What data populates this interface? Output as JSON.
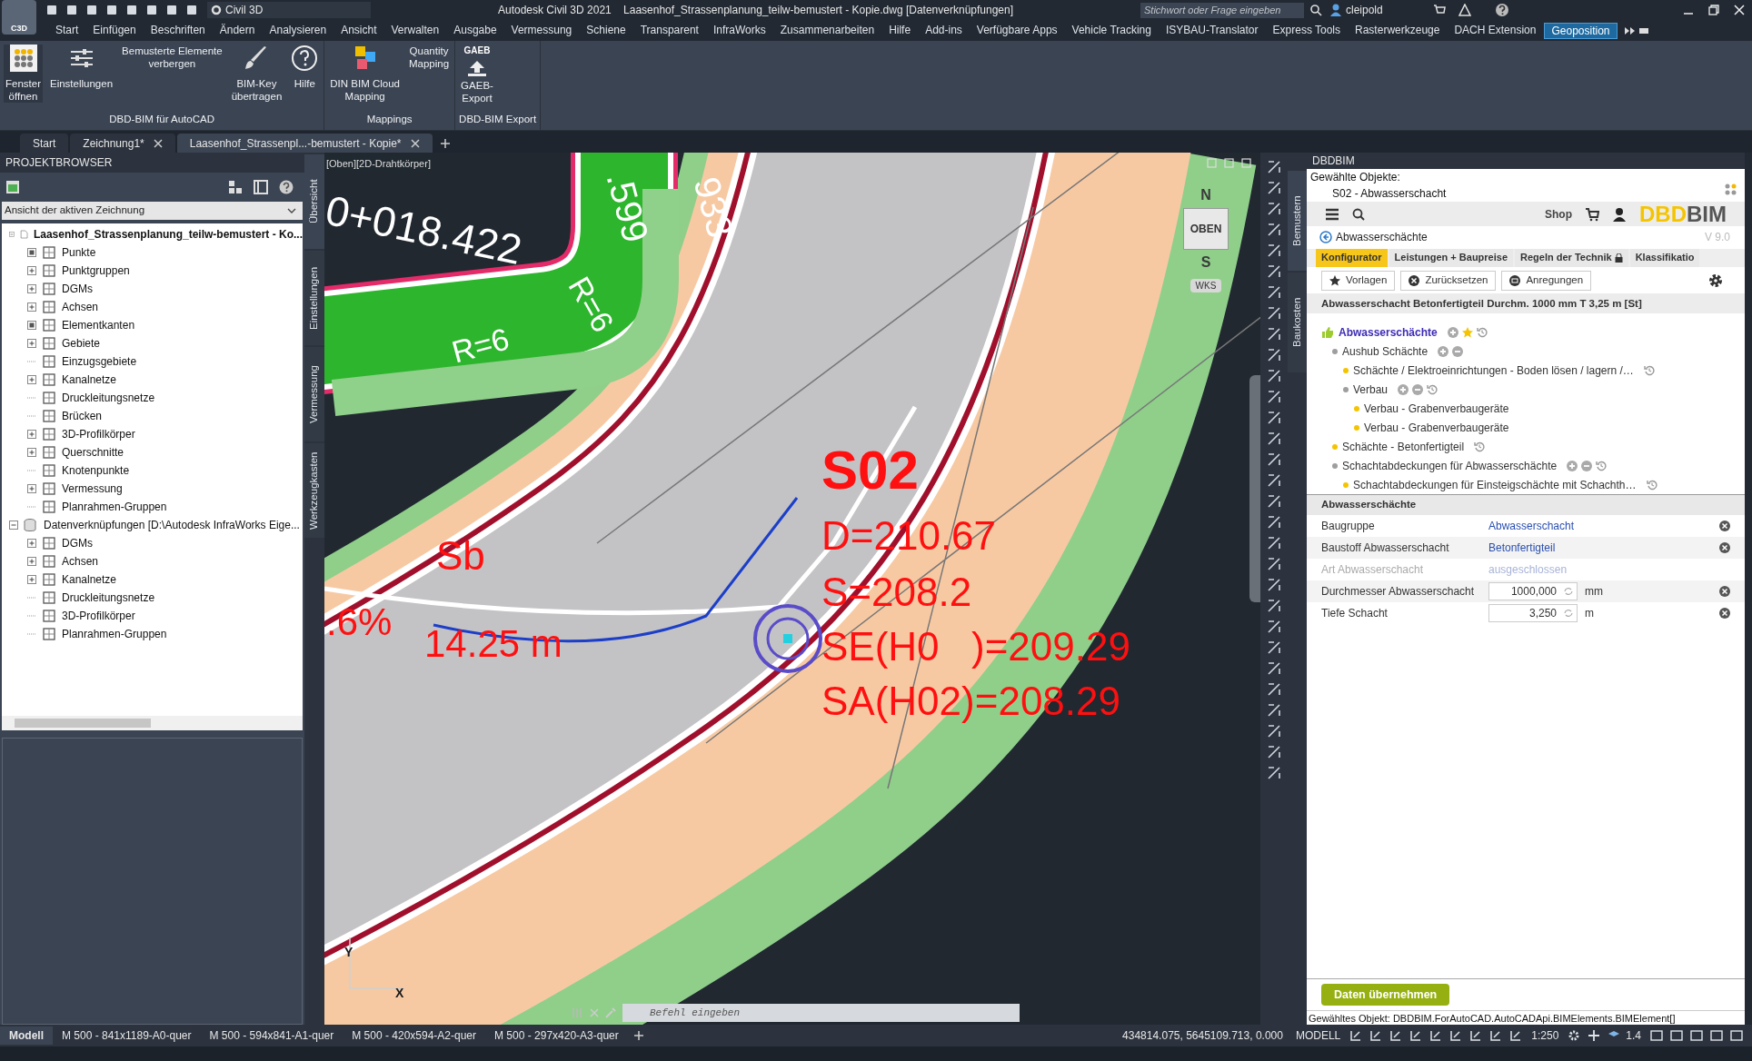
{
  "title_bar": {
    "app_badge": "C3D",
    "workspace": "Civil 3D",
    "title": "Autodesk Civil 3D 2021    Laasenhof_Strassenplanung_teilw-bemustert - Kopie.dwg [Datenverknüpfungen]",
    "search": {
      "placeholder": "Stichwort oder Frage eingeben"
    },
    "user": "cleipold"
  },
  "menu": [
    {
      "label": "Start",
      "selected": false
    },
    {
      "label": "Einfügen",
      "selected": false
    },
    {
      "label": "Beschriften",
      "selected": false
    },
    {
      "label": "Ändern",
      "selected": false
    },
    {
      "label": "Analysieren",
      "selected": false
    },
    {
      "label": "Ansicht",
      "selected": false
    },
    {
      "label": "Verwalten",
      "selected": false
    },
    {
      "label": "Ausgabe",
      "selected": false
    },
    {
      "label": "Vermessung",
      "selected": false
    },
    {
      "label": "Schiene",
      "selected": false
    },
    {
      "label": "Transparent",
      "selected": false
    },
    {
      "label": "InfraWorks",
      "selected": false
    },
    {
      "label": "Zusammenarbeiten",
      "selected": false
    },
    {
      "label": "Hilfe",
      "selected": false
    },
    {
      "label": "Add-ins",
      "selected": false
    },
    {
      "label": "Verfügbare Apps",
      "selected": false
    },
    {
      "label": "Vehicle Tracking",
      "selected": false
    },
    {
      "label": "ISYBAU-Translator",
      "selected": false
    },
    {
      "label": "Express Tools",
      "selected": false
    },
    {
      "label": "Rasterwerkzeuge",
      "selected": false
    },
    {
      "label": "DACH Extension",
      "selected": false
    },
    {
      "label": "Geoposition",
      "selected": true
    }
  ],
  "ribbon": [
    {
      "title": "DBD-BIM für AutoCAD",
      "buttons": [
        {
          "kind": "grid",
          "label": "Fenster\nöffnen"
        },
        {
          "kind": "sliders",
          "label": "Einstellungen"
        },
        {
          "kind": "text",
          "label": "Bemusterte Elemente\nverbergen"
        },
        {
          "kind": "brush",
          "label": "BIM-Key\nübertragen"
        },
        {
          "kind": "help",
          "label": "Hilfe"
        }
      ]
    },
    {
      "title": "Mappings",
      "buttons": [
        {
          "kind": "cubes",
          "label": "DIN BIM Cloud\nMapping"
        },
        {
          "kind": "text",
          "label": "Quantity\nMapping"
        }
      ]
    },
    {
      "title": "DBD-BIM Export",
      "buttons": [
        {
          "kind": "gaeb",
          "icon_text": "GAEB",
          "label": "GAEB-\nExport"
        }
      ]
    }
  ],
  "doc_tabs": [
    {
      "label": "Start",
      "selected": false,
      "closable": false
    },
    {
      "label": "Zeichnung1*",
      "selected": false,
      "closable": true
    },
    {
      "label": "Laasenhof_Strassenpl...-bemustert - Kopie*",
      "selected": true,
      "closable": true
    }
  ],
  "project_browser": {
    "title": "PROJEKTBROWSER",
    "view": "Ansicht der aktiven Zeichnung",
    "tree": [
      {
        "label": "Laasenhof_Strassenplanung_teilw-bemustert - Ko...",
        "expanded": true,
        "children": [
          {
            "label": "Punkte",
            "kind": "dot"
          },
          {
            "label": "Punktgruppen",
            "kind": "plus"
          },
          {
            "label": "DGMs",
            "kind": "plus"
          },
          {
            "label": "Achsen",
            "kind": "plus"
          },
          {
            "label": "Elementkanten",
            "kind": "dot"
          },
          {
            "label": "Gebiete",
            "kind": "plus"
          },
          {
            "label": "Einzugsgebiete",
            "kind": "leaf"
          },
          {
            "label": "Kanalnetze",
            "kind": "plus"
          },
          {
            "label": "Druckleitungsnetze",
            "kind": "leaf"
          },
          {
            "label": "Brücken",
            "kind": "leaf"
          },
          {
            "label": "3D-Profilkörper",
            "kind": "plus"
          },
          {
            "label": "Querschnitte",
            "kind": "plus"
          },
          {
            "label": "Knotenpunkte",
            "kind": "leaf"
          },
          {
            "label": "Vermessung",
            "kind": "plus"
          },
          {
            "label": "Planrahmen-Gruppen",
            "kind": "leaf"
          }
        ]
      },
      {
        "label": "Datenverknüpfungen [D:\\Autodesk InfraWorks Eige...",
        "expanded": true,
        "children": [
          {
            "label": "DGMs",
            "kind": "plus"
          },
          {
            "label": "Achsen",
            "kind": "plus"
          },
          {
            "label": "Kanalnetze",
            "kind": "plus"
          },
          {
            "label": "Druckleitungsnetze",
            "kind": "leaf"
          },
          {
            "label": "3D-Profilkörper",
            "kind": "leaf"
          },
          {
            "label": "Planrahmen-Gruppen",
            "kind": "leaf"
          }
        ]
      }
    ]
  },
  "left_side_tabs": [
    {
      "label": "Übersicht",
      "selected": true
    },
    {
      "label": "Einstellungen",
      "selected": false
    },
    {
      "label": "Vermessung",
      "selected": false
    },
    {
      "label": "Werkzeugkasten",
      "selected": false
    }
  ],
  "viewport": {
    "label": "[Oben][2D-Drahtkörper]",
    "labels": [
      {
        "kind": "white",
        "text": "0+018.422"
      },
      {
        "kind": "white",
        "text": ".599"
      },
      {
        "kind": "white",
        "text": "933"
      },
      {
        "kind": "white",
        "text": "R=6"
      },
      {
        "kind": "white",
        "text": "R=6"
      },
      {
        "kind": "red",
        "text": "S02"
      },
      {
        "kind": "red",
        "text": "D=210.67"
      },
      {
        "kind": "red",
        "text": "S=208.2"
      },
      {
        "kind": "red",
        "text": "SE(H0"
      },
      {
        "kind": "red",
        "text": ")=209.29"
      },
      {
        "kind": "red",
        "text": "SA(H02)=208.29"
      },
      {
        "kind": "red",
        "text": "Sb"
      },
      {
        "kind": "red",
        "text": ".6%"
      },
      {
        "kind": "red",
        "text": "14.25 m"
      }
    ],
    "viewcube": {
      "face": "OBEN",
      "north": "N",
      "south": "S",
      "ucs": "WKS"
    },
    "axis_x": "X",
    "axis_y": "Y"
  },
  "command_line": {
    "placeholder": "Befehl eingeben"
  },
  "right_side_tabs": [
    {
      "label": "Bemustern",
      "selected": true
    },
    {
      "label": "Baukosten",
      "selected": false
    }
  ],
  "dbdbim": {
    "title": "DBDBIM",
    "selected_caption": "Gewählte Objekte:",
    "selected_object": "S02 - Abwasserschacht",
    "shop": "Shop",
    "logo": "DBDBIM",
    "breadcrumb": "Abwasserschächte",
    "version": "V 9.0",
    "tabs": [
      {
        "label": "Konfigurator",
        "selected": true,
        "locked": false
      },
      {
        "label": "Leistungen + Baupreise",
        "selected": false,
        "locked": false
      },
      {
        "label": "Regeln der Technik",
        "selected": false,
        "locked": true
      },
      {
        "label": "Klassifikatio",
        "selected": false,
        "locked": false
      }
    ],
    "tools": [
      {
        "kind": "star",
        "label": "Vorlagen"
      },
      {
        "kind": "reset",
        "label": "Zurücksetzen"
      },
      {
        "kind": "mail",
        "label": "Anregungen"
      }
    ],
    "heading": "Abwasserschacht Betonfertigteil Durchm. 1000 mm T 3,25 m [St]",
    "tree": [
      {
        "label": "Abwasserschächte",
        "root": true,
        "can_add": true,
        "can_remove": false,
        "starred": true,
        "has_history": true,
        "children": [
          {
            "label": "Aushub Schächte",
            "color": "#9e9e9e",
            "can_add": true,
            "can_remove": true,
            "starred": false,
            "has_history": false,
            "children": [
              {
                "label": "Schächte / Elektroeinrichtungen - Boden lösen / lagern /…",
                "color": "#f5c400",
                "can_add": false,
                "can_remove": false,
                "starred": false,
                "has_history": true
              },
              {
                "label": "Verbau",
                "color": "#9e9e9e",
                "can_add": true,
                "can_remove": true,
                "starred": false,
                "has_history": true,
                "children": [
                  {
                    "label": "Verbau - Grabenverbaugeräte",
                    "color": "#f5c400",
                    "can_add": false,
                    "can_remove": false,
                    "starred": false,
                    "has_history": false
                  },
                  {
                    "label": "Verbau - Grabenverbaugeräte",
                    "color": "#f5c400",
                    "can_add": false,
                    "can_remove": false,
                    "starred": false,
                    "has_history": false
                  }
                ]
              }
            ]
          },
          {
            "label": "Schächte - Betonfertigteil",
            "color": "#f5c400",
            "can_add": false,
            "can_remove": false,
            "starred": false,
            "has_history": true
          },
          {
            "label": "Schachtabdeckungen für Abwasserschächte",
            "color": "#9e9e9e",
            "can_add": true,
            "can_remove": true,
            "starred": false,
            "has_history": true,
            "children": [
              {
                "label": "Schachtabdeckungen für Einsteigschächte mit Schachth…",
                "color": "#f5c400",
                "can_add": false,
                "can_remove": false,
                "starred": false,
                "has_history": true
              }
            ]
          }
        ]
      }
    ],
    "properties": {
      "title": "Abwasserschächte",
      "rows": [
        {
          "kind": "link",
          "label": "Baugruppe",
          "value": "Abwasserschacht"
        },
        {
          "kind": "link",
          "label": "Baustoff Abwasserschacht",
          "value": "Betonfertigteil"
        },
        {
          "kind": "disabled",
          "label": "Art Abwasserschacht",
          "value": "ausgeschlossen"
        },
        {
          "kind": "number",
          "label": "Durchmesser Abwasserschacht",
          "value": "1000,000",
          "unit": "mm"
        },
        {
          "kind": "number",
          "label": "Tiefe Schacht",
          "value": "3,250",
          "unit": "m"
        }
      ]
    },
    "apply_button": "Daten übernehmen",
    "status": "Gewähltes Objekt: DBDBIM.ForAutoCAD.AutoCADApi.BIMElements.BIMElement[]"
  },
  "layout_tabs": [
    {
      "label": "Modell",
      "selected": true
    },
    {
      "label": "M 500 - 841x1189-A0-quer",
      "selected": false
    },
    {
      "label": "M 500 - 594x841-A1-quer",
      "selected": false
    },
    {
      "label": "M 500 - 420x594-A2-quer",
      "selected": false
    },
    {
      "label": "M 500 - 297x420-A3-quer",
      "selected": false
    }
  ],
  "status_bar": {
    "coordinates": "434814.075, 5645109.713, 0.000",
    "mode": "MODELL",
    "scale": "1:250",
    "lineweight": "1.4"
  }
}
